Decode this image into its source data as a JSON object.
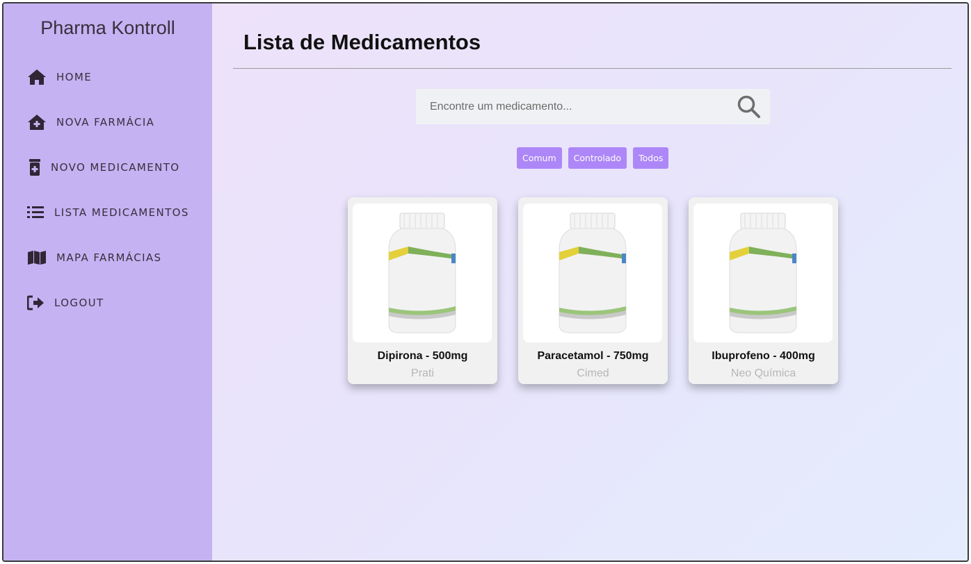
{
  "app": {
    "brand": "Pharma Kontroll"
  },
  "sidebar": {
    "items": [
      {
        "label": "HOME",
        "icon": "home-icon"
      },
      {
        "label": "NOVA FARMÁCIA",
        "icon": "house-plus-icon"
      },
      {
        "label": "NOVO MEDICAMENTO",
        "icon": "medicine-bottle-icon"
      },
      {
        "label": "LISTA MEDICAMENTOS",
        "icon": "list-icon"
      },
      {
        "label": "MAPA FARMÁCIAS",
        "icon": "map-icon"
      },
      {
        "label": "LOGOUT",
        "icon": "logout-icon"
      }
    ]
  },
  "main": {
    "title": "Lista de Medicamentos",
    "search": {
      "placeholder": "Encontre um medicamento...",
      "icon": "search-icon"
    },
    "filters": [
      "Comum",
      "Controlado",
      "Todos"
    ],
    "cards": [
      {
        "name": "Dipirona - 500mg",
        "lab": "Prati"
      },
      {
        "name": "Paracetamol - 750mg",
        "lab": "Cimed"
      },
      {
        "name": "Ibuprofeno - 400mg",
        "lab": "Neo Química"
      }
    ]
  },
  "colors": {
    "sidebar": "#c5b2f2",
    "accent": "#ad87f7",
    "text_dark": "#3a2e3e"
  }
}
